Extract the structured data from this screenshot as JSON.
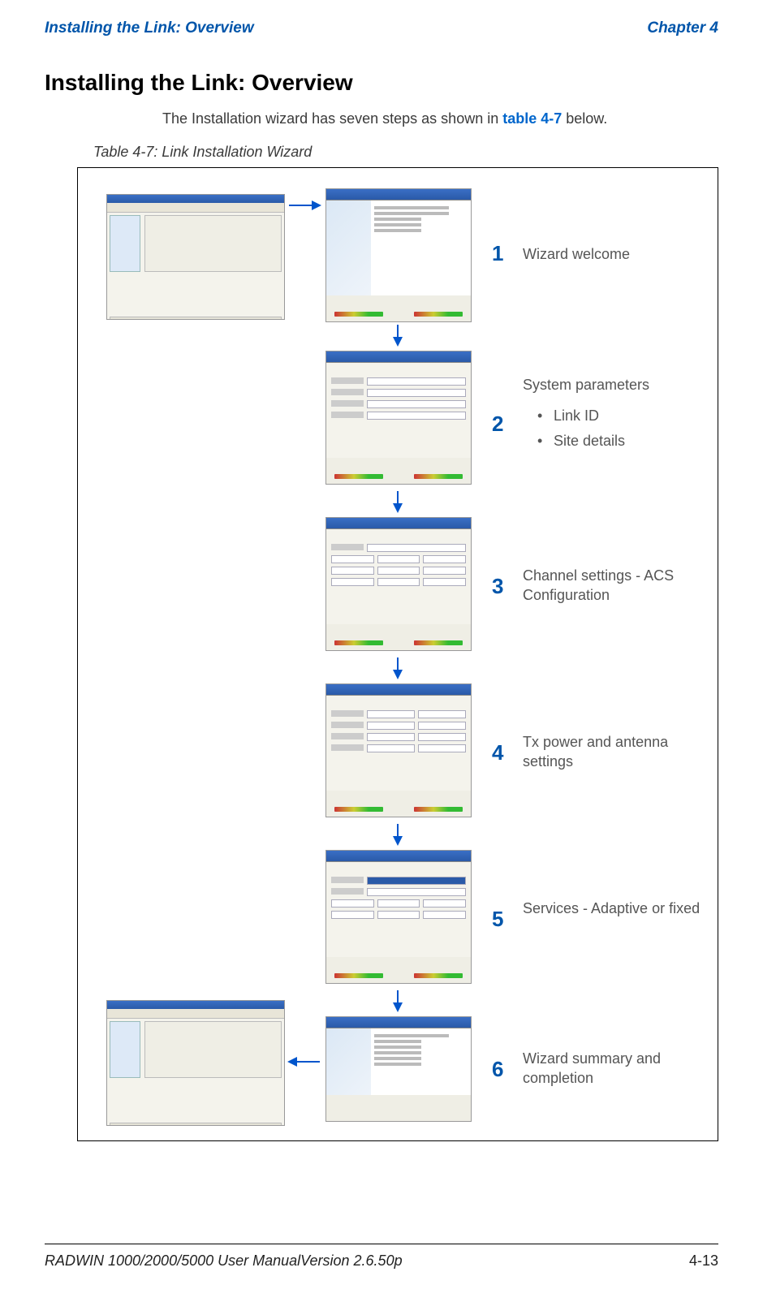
{
  "header": {
    "section_title": "Installing the Link: Overview",
    "chapter": "Chapter 4"
  },
  "page": {
    "heading": "Installing the Link: Overview",
    "intro_prefix": "The Installation wizard has seven steps as shown in ",
    "intro_link": "table 4-7",
    "intro_suffix": " below.",
    "table_caption": "Table 4-7: Link Installation Wizard"
  },
  "steps": [
    {
      "num": "1",
      "label": "Wizard welcome"
    },
    {
      "num": "2",
      "label": "System parameters",
      "bullets": [
        "Link ID",
        "Site details"
      ]
    },
    {
      "num": "3",
      "label": "Channel settings - ACS Configuration"
    },
    {
      "num": "4",
      "label": "Tx power and antenna settings"
    },
    {
      "num": "5",
      "label": "Services - Adaptive or fixed"
    },
    {
      "num": "6",
      "label": "Wizard summary and completion"
    }
  ],
  "footer": {
    "manual": "RADWIN 1000/2000/5000 User Manual",
    "version": "Version  2.6.50p",
    "page_num": "4-13"
  }
}
